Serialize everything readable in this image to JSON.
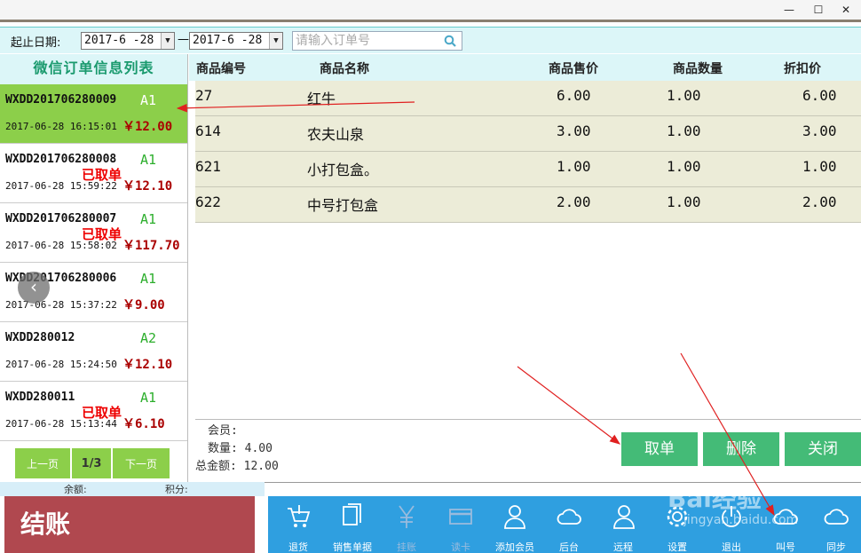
{
  "window": {
    "min_glyph": "—",
    "max_glyph": "☐",
    "close_glyph": "✕"
  },
  "filter": {
    "label": "起止日期:",
    "start_date": "2017-6 -28",
    "end_date": "2017-6 -28",
    "separator": "—",
    "search_placeholder": "请输入订单号"
  },
  "order_list": {
    "title": "微信订单信息列表",
    "orders": [
      {
        "no": "WXDD201706280009",
        "table": "A1",
        "time": "2017-06-28 16:15:01",
        "amount": "￥12.00",
        "status": ""
      },
      {
        "no": "WXDD201706280008",
        "table": "A1",
        "time": "2017-06-28 15:59:22",
        "amount": "￥12.10",
        "status": "已取单"
      },
      {
        "no": "WXDD201706280007",
        "table": "A1",
        "time": "2017-06-28 15:58:02",
        "amount": "￥117.70",
        "status": "已取单"
      },
      {
        "no": "WXDD201706280006",
        "table": "A1",
        "time": "2017-06-28 15:37:22",
        "amount": "￥9.00",
        "status": ""
      },
      {
        "no": "WXDD280012",
        "table": "A2",
        "time": "2017-06-28 15:24:50",
        "amount": "￥12.10",
        "status": ""
      },
      {
        "no": "WXDD280011",
        "table": "A1",
        "time": "2017-06-28 15:13:44",
        "amount": "￥6.10",
        "status": "已取单"
      }
    ],
    "pager": {
      "prev": "上一页",
      "page": "1/3",
      "next": "下一页"
    }
  },
  "products": {
    "columns": [
      "商品编号",
      "商品名称",
      "商品售价",
      "商品数量",
      "折扣价"
    ],
    "rows": [
      {
        "code": "27",
        "name": "红牛",
        "price": "6.00",
        "qty": "1.00",
        "disc": "6.00"
      },
      {
        "code": "614",
        "name": "农夫山泉",
        "price": "3.00",
        "qty": "1.00",
        "disc": "3.00"
      },
      {
        "code": "621",
        "name": "小打包盒。",
        "price": "1.00",
        "qty": "1.00",
        "disc": "1.00"
      },
      {
        "code": "622",
        "name": "中号打包盒",
        "price": "2.00",
        "qty": "1.00",
        "disc": "2.00"
      }
    ]
  },
  "summary": {
    "member_label": "会员:",
    "qty_label": "数量:",
    "qty_value": "4.00",
    "total_label": "总金额:",
    "total_value": "12.00"
  },
  "actions": {
    "take": "取单",
    "delete": "删除",
    "close": "关闭"
  },
  "bottom": {
    "balance_label": "余额:",
    "points_label": "积分:",
    "checkout": "结账",
    "tools": [
      {
        "label": "退货",
        "icon": "cart-icon"
      },
      {
        "label": "销售单据",
        "icon": "documents-icon"
      },
      {
        "label": "挂账",
        "icon": "yen-icon"
      },
      {
        "label": "读卡",
        "icon": "card-icon"
      },
      {
        "label": "添加会员",
        "icon": "user-icon"
      },
      {
        "label": "后台",
        "icon": "cloud-icon"
      },
      {
        "label": "远程",
        "icon": "users-icon"
      },
      {
        "label": "设置",
        "icon": "gear-icon"
      },
      {
        "label": "退出",
        "icon": "power-icon"
      },
      {
        "label": "叫号",
        "icon": "cloud-icon"
      },
      {
        "label": "同步",
        "icon": "cloud-icon"
      }
    ]
  },
  "watermark": {
    "brand": "Bai经验",
    "url": "jingyan.baidu.com"
  },
  "colors": {
    "accent_green": "#44bb77",
    "list_active": "#8ccf4a",
    "checkout": "#b0484f",
    "toolbar": "#2f9fe0",
    "header_bg": "#dcf6f8"
  }
}
